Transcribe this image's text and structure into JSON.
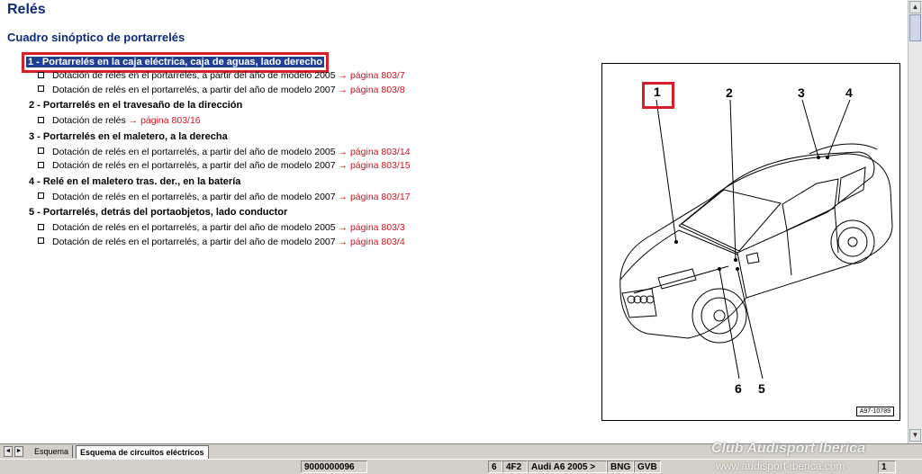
{
  "page": {
    "title": "Relés",
    "subtitle": "Cuadro sinóptico de portarrelés"
  },
  "items": [
    {
      "label": "1 - Portarrelés en la caja eléctrica, caja de aguas, lado derecho",
      "subs": [
        {
          "text": "Dotación de relés en el portarrelés, a partir del año de modelo 2005",
          "link": "página 803/7"
        },
        {
          "text": "Dotación de relés en el portarrelés, a partir del año de modelo 2007",
          "link": "página 803/8"
        }
      ]
    },
    {
      "label": "2 - Portarrelés en el travesaño de la dirección",
      "subs": [
        {
          "text": "Dotación de relés",
          "link": "página 803/16"
        }
      ]
    },
    {
      "label": "3 - Portarrelés en el maletero, a la derecha",
      "subs": [
        {
          "text": "Dotación de relés en el portarrelés, a partir del año de modelo 2005",
          "link": "página 803/14"
        },
        {
          "text": "Dotación de relés en el portarrelés, a partir del año de modelo 2007",
          "link": "página 803/15"
        }
      ]
    },
    {
      "label": "4 - Relé en el maletero tras. der., en la batería",
      "subs": [
        {
          "text": "Dotación de relés en el portarrelés, a partir del año de modelo 2007",
          "link": "página 803/17"
        }
      ]
    },
    {
      "label": "5 - Portarrelés, detrás del portaobjetos, lado conductor",
      "subs": [
        {
          "text": "Dotación de relés en el portarrelés, a partir del año de modelo 2005",
          "link": "página 803/3"
        },
        {
          "text": "Dotación de relés en el portarrelés, a partir del año de modelo 2007",
          "link": "página 803/4"
        }
      ]
    }
  ],
  "link_arrow": "→",
  "figure": {
    "callouts": [
      "1",
      "2",
      "3",
      "4",
      "5",
      "6"
    ],
    "ref": "A97-10789"
  },
  "tabs": {
    "nav_prev": "◄",
    "nav_next": "►",
    "tab1": "Esquema",
    "tab2": "Esquema de circuitos eléctricos"
  },
  "status": {
    "doc_number": "9000000096",
    "c1": "6",
    "c2": "4F2",
    "c3": "Audi A6 2005 >",
    "c4": "BNG",
    "c5": "GVB",
    "c6": "1"
  },
  "watermark": {
    "line1": "Club Audisport Iberica",
    "line2": "www.audisport-iberica.com"
  },
  "colors": {
    "heading": "#0a2a7a",
    "link": "#d2131f",
    "highlight_bg": "#1f3f94",
    "highlight_box": "#d81e2a"
  }
}
